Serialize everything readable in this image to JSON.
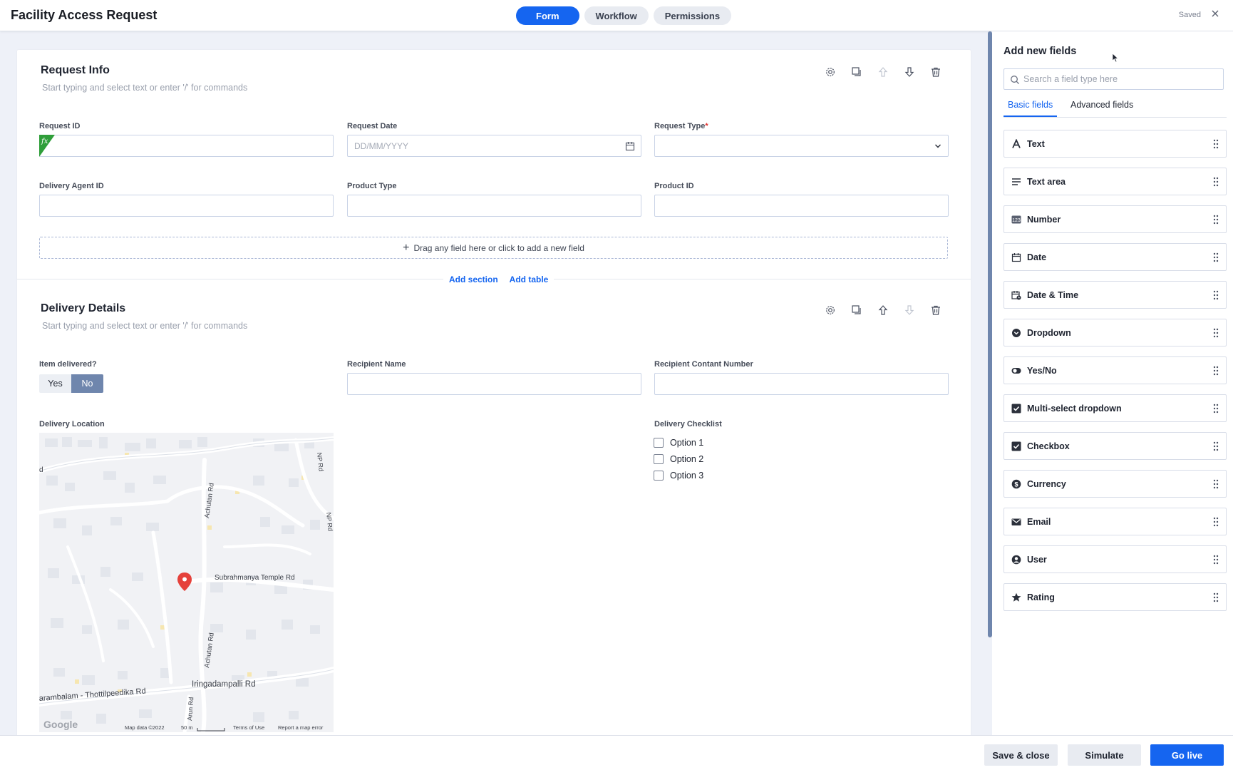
{
  "header": {
    "title": "Facility Access Request",
    "tabs": [
      "Form",
      "Workflow",
      "Permissions"
    ],
    "saved": "Saved"
  },
  "sections": [
    {
      "title": "Request Info",
      "hint": "Start typing and select text or enter '/' for commands"
    },
    {
      "title": "Delivery Details",
      "hint": "Start typing and select text or enter '/' for commands"
    }
  ],
  "fields": {
    "request_id": "Request ID",
    "request_date": "Request Date",
    "request_date_placeholder": "DD/MM/YYYY",
    "request_type": "Request Type",
    "delivery_agent_id": "Delivery Agent ID",
    "product_type": "Product Type",
    "product_id": "Product ID",
    "item_delivered": "Item delivered?",
    "yes": "Yes",
    "no": "No",
    "recipient_name": "Recipient Name",
    "recipient_number": "Recipient Contant Number",
    "delivery_location": "Delivery Location",
    "delivery_checklist": "Delivery Checklist",
    "options": [
      "Option 1",
      "Option 2",
      "Option 3"
    ],
    "fx": "fx"
  },
  "dropzone": "Drag any field here or click to add a new field",
  "add_section": "Add section",
  "add_table": "Add table",
  "map": {
    "roads": [
      "Subrahmanya Temple Rd",
      "Achutan Rd",
      "Achutan Rd",
      "Iringadampalli Rd",
      "arambalam - Thottilpeedika Rd",
      "Arun Rd",
      "NP Rd",
      "NP Rd"
    ],
    "edge_letter": "d",
    "google": "Google",
    "map_data": "Map data ©2022",
    "scale": "50 m",
    "terms": "Terms of Use",
    "report": "Report a map error"
  },
  "panel": {
    "title": "Add new fields",
    "search_placeholder": "Search a field type here",
    "tabs": [
      "Basic fields",
      "Advanced fields"
    ],
    "items": [
      {
        "label": "Text",
        "icon": "text-icon"
      },
      {
        "label": "Text area",
        "icon": "text-area-icon"
      },
      {
        "label": "Number",
        "icon": "number-icon"
      },
      {
        "label": "Date",
        "icon": "calendar-icon"
      },
      {
        "label": "Date & Time",
        "icon": "calendar-clock-icon"
      },
      {
        "label": "Dropdown",
        "icon": "dropdown-icon"
      },
      {
        "label": "Yes/No",
        "icon": "toggle-icon"
      },
      {
        "label": "Multi-select dropdown",
        "icon": "checked-box-icon"
      },
      {
        "label": "Checkbox",
        "icon": "checked-box-icon"
      },
      {
        "label": "Currency",
        "icon": "dollar-icon"
      },
      {
        "label": "Email",
        "icon": "envelope-icon"
      },
      {
        "label": "User",
        "icon": "user-icon"
      },
      {
        "label": "Rating",
        "icon": "star-icon"
      }
    ]
  },
  "footer": {
    "save_close": "Save & close",
    "simulate": "Simulate",
    "go_live": "Go live"
  },
  "colors": {
    "accent": "#1565f0",
    "formula": "#2f9e3a",
    "required": "#e0302d",
    "toggle_selected": "#6f86ad"
  }
}
